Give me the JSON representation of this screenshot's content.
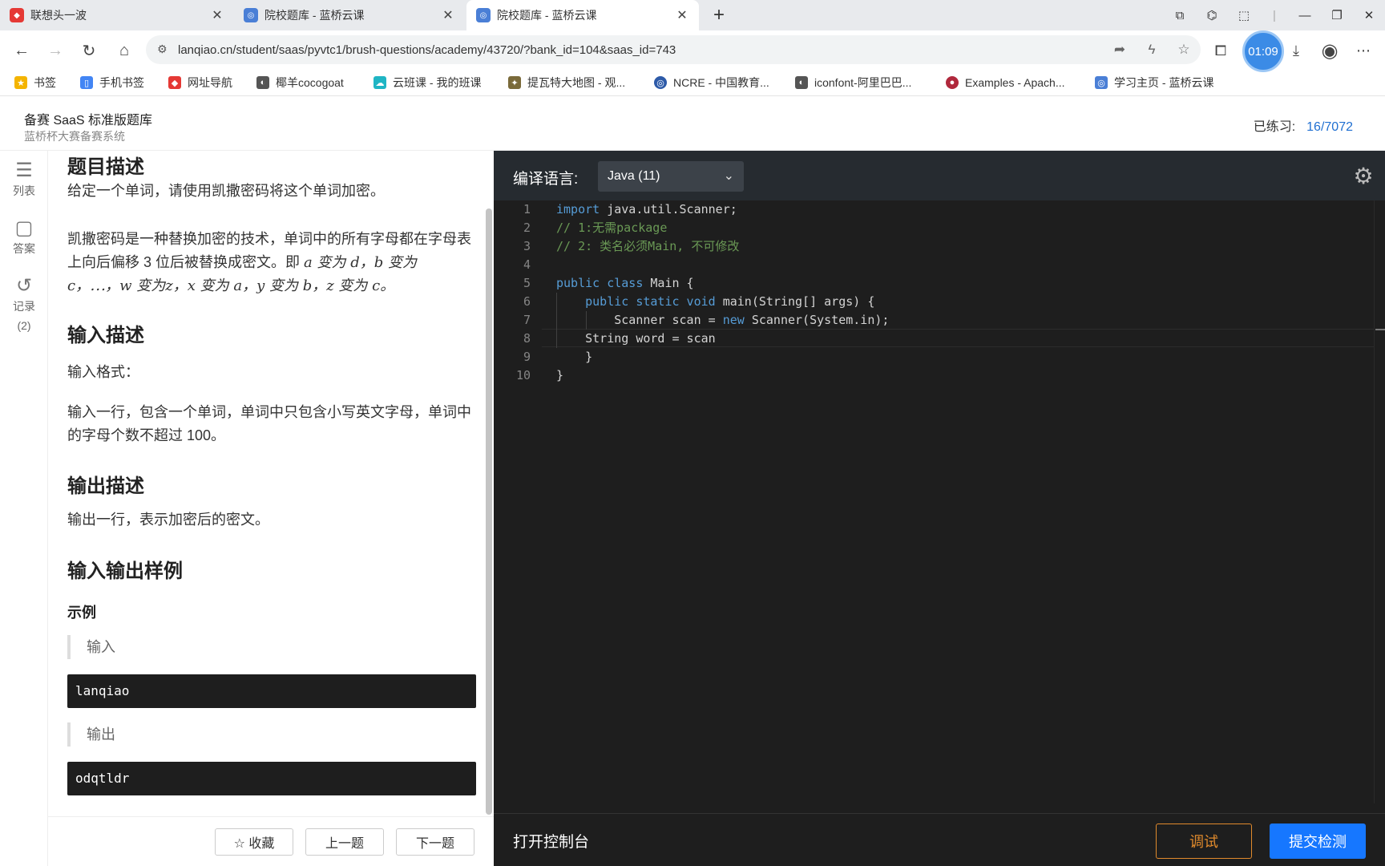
{
  "browser": {
    "tabs": [
      {
        "title": "联想头一波",
        "favicon_color": "#e53935",
        "active": false
      },
      {
        "title": "院校题库 - 蓝桥云课",
        "favicon_color": "#4a7fd6",
        "active": false
      },
      {
        "title": "院校题库 - 蓝桥云课",
        "favicon_color": "#4a7fd6",
        "active": true
      }
    ],
    "new_tab": "+",
    "url": "lanqiao.cn/student/saas/pyvtc1/brush-questions/academy/43720/?bank_id=104&saas_id=743",
    "timer": "01:09",
    "bookmarks": [
      {
        "label": "书签",
        "color": "#f4b400"
      },
      {
        "label": "手机书签",
        "color": "#4285f4"
      },
      {
        "label": "网址导航",
        "color": "#e53935"
      },
      {
        "label": "椰羊cocogoat",
        "color": "#555555"
      },
      {
        "label": "云班课 - 我的班课",
        "color": "#1fb5c4"
      },
      {
        "label": "提瓦特大地图 - 观...",
        "color": "#7a6a3a"
      },
      {
        "label": "NCRE - 中国教育...",
        "color": "#2d5aa8"
      },
      {
        "label": "iconfont-阿里巴巴...",
        "color": "#555555"
      },
      {
        "label": "Examples - Apach...",
        "color": "#b0283c"
      },
      {
        "label": "学习主页 - 蓝桥云课",
        "color": "#4a7fd6"
      }
    ]
  },
  "header": {
    "title": "备赛 SaaS 标准版题库",
    "subtitle": "蓝桥杯大赛备赛系统",
    "progress_label": "已练习:",
    "progress_value": "16/7072"
  },
  "rail": {
    "list": "列表",
    "answer": "答案",
    "record": "记录",
    "record_count": "(2)"
  },
  "problem": {
    "desc_title": "题目描述",
    "desc_p1": "给定一个单词，请使用凯撒密码将这个单词加密。",
    "desc_p2a": "凯撒密码是一种替换加密的技术，单词中的所有字母都在字母表上向后偏移 3 位后被替换成密文。即 ",
    "desc_p2_line2": "a 变为 d，b 变为",
    "desc_p2_line3": "c，⋯，w 变为z，x 变为 a，y 变为 b，z 变为 c。",
    "input_title": "输入描述",
    "input_format": "输入格式：",
    "input_desc": "输入一行，包含一个单词，单词中只包含小写英文字母，单词中的字母个数不超过 100。",
    "output_title": "输出描述",
    "output_desc": "输出一行，表示加密后的密文。",
    "sample_title": "输入输出样例",
    "example_label": "示例",
    "sample_input_label": "输入",
    "sample_input": "lanqiao",
    "sample_output_label": "输出",
    "sample_output": "odqtldr"
  },
  "footer": {
    "favorite": "☆ 收藏",
    "prev": "上一题",
    "next": "下一题"
  },
  "editor": {
    "lang_label": "编译语言:",
    "lang_value": "Java  (11)",
    "lines": [
      {
        "n": "1",
        "parts": [
          [
            "kw",
            "import"
          ],
          [
            "",
            " java.util.Scanner;"
          ]
        ]
      },
      {
        "n": "2",
        "parts": [
          [
            "cm",
            "// 1:无需package"
          ]
        ]
      },
      {
        "n": "3",
        "parts": [
          [
            "cm",
            "// 2: 类名必须Main, 不可修改"
          ]
        ]
      },
      {
        "n": "4",
        "parts": []
      },
      {
        "n": "5",
        "parts": [
          [
            "kw",
            "public class"
          ],
          [
            "",
            " Main {"
          ]
        ]
      },
      {
        "n": "6",
        "parts": [
          [
            "",
            "    "
          ],
          [
            "kw",
            "public static void"
          ],
          [
            "",
            " main(String[] args) {"
          ]
        ]
      },
      {
        "n": "7",
        "parts": [
          [
            "",
            "        Scanner scan = "
          ],
          [
            "kw",
            "new"
          ],
          [
            "",
            " Scanner(System.in);"
          ]
        ]
      },
      {
        "n": "8",
        "parts": [
          [
            "",
            "    String word = scan"
          ]
        ]
      },
      {
        "n": "9",
        "parts": [
          [
            "",
            "    }"
          ]
        ]
      },
      {
        "n": "10",
        "parts": [
          [
            "",
            "}"
          ]
        ]
      }
    ],
    "console_toggle": "打开控制台",
    "debug": "调试",
    "submit": "提交检测"
  }
}
